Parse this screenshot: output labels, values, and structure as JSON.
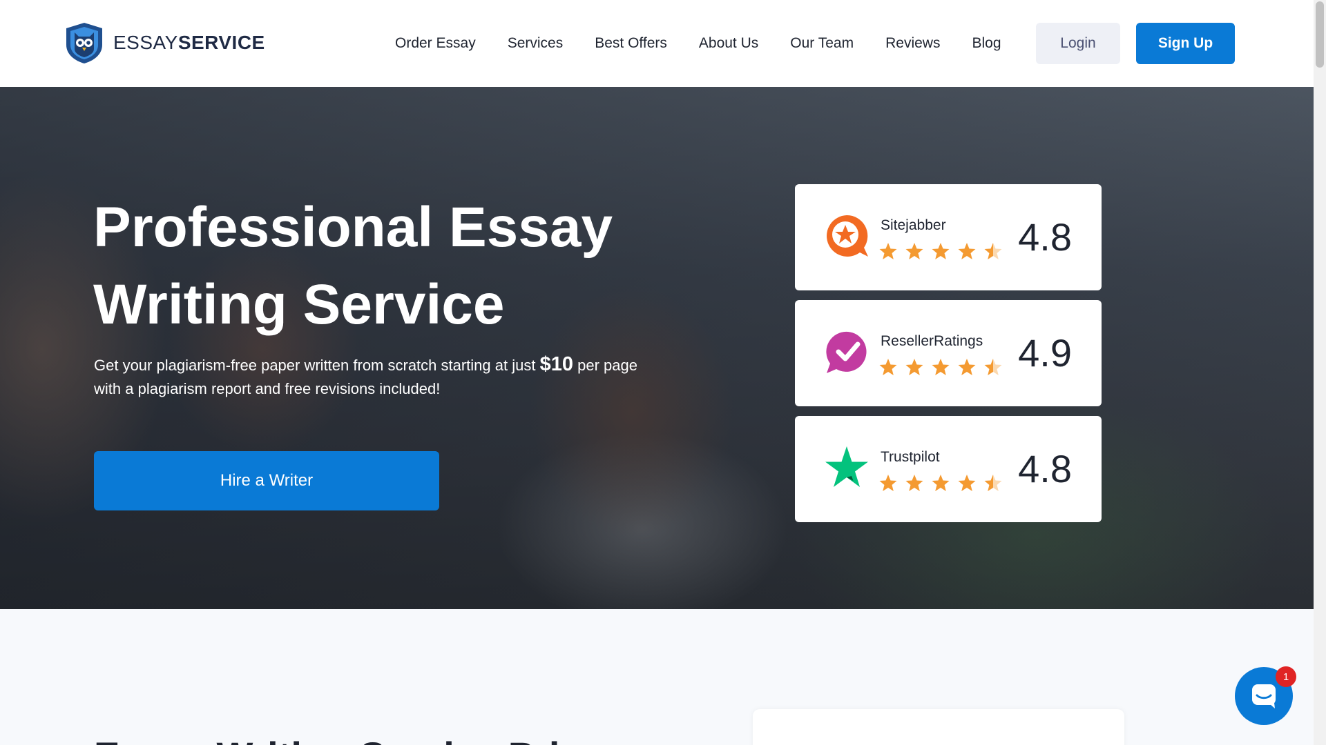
{
  "header": {
    "logo": {
      "text_light": "ESSAY",
      "text_bold": "SERVICE",
      "icon": "owl-shield-icon"
    },
    "nav": [
      "Order Essay",
      "Services",
      "Best Offers",
      "About Us",
      "Our Team",
      "Reviews",
      "Blog"
    ],
    "login_label": "Login",
    "signup_label": "Sign Up"
  },
  "hero": {
    "title_line1": "Professional Essay",
    "title_line2": "Writing Service",
    "subtitle_pre": "Get your plagiarism-free paper written from scratch starting at just",
    "price": "$10",
    "subtitle_post": "per page",
    "subtitle_line2": "with a plagiarism report and free revisions included!",
    "cta_label": "Hire a Writer"
  },
  "ratings": [
    {
      "name": "Sitejabber",
      "score": "4.8",
      "icon": "sitejabber-icon",
      "stars": 4.5
    },
    {
      "name": "ResellerRatings",
      "score": "4.9",
      "icon": "resellerratings-icon",
      "stars": 4.5
    },
    {
      "name": "Trustpilot",
      "score": "4.8",
      "icon": "trustpilot-star-icon",
      "stars": 4.5
    }
  ],
  "lower": {
    "heading_partial": "Essay Writing Service Price"
  },
  "chat": {
    "badge": "1",
    "icon": "chat-icon"
  },
  "colors": {
    "primary": "#0a7ad6",
    "star": "#f49a31",
    "sitejabber": "#f26a22",
    "resellerratings": "#c23ba0",
    "trustpilot": "#04c27d",
    "badge": "#e02424"
  }
}
